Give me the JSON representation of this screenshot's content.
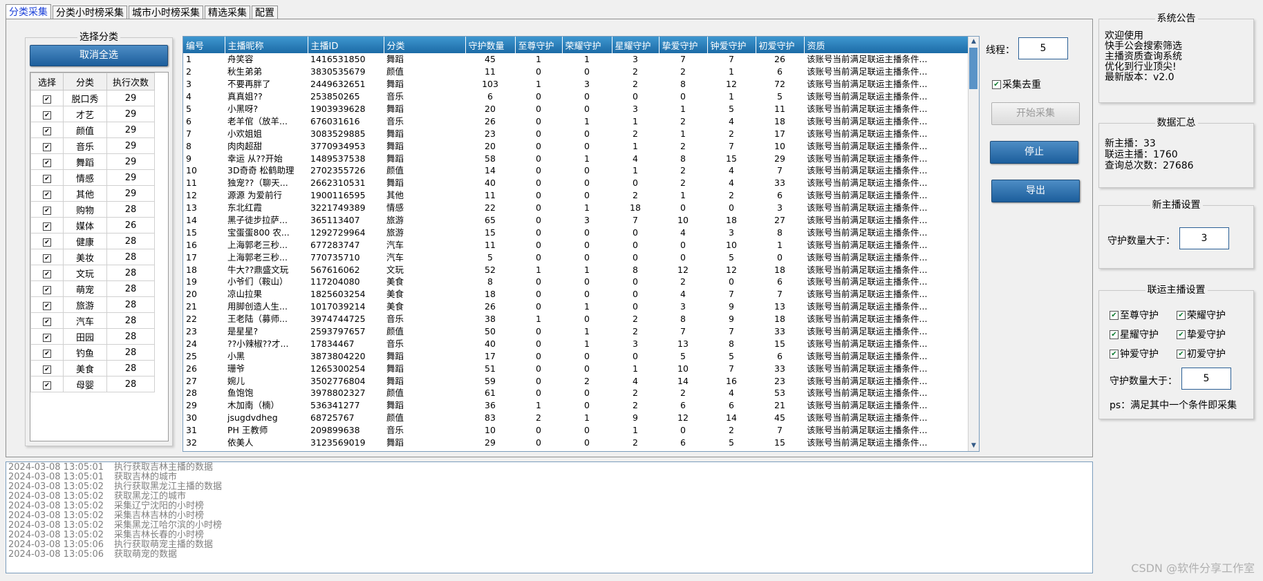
{
  "tabs": [
    "分类采集",
    "分类小时榜采集",
    "城市小时榜采集",
    "精选采集",
    "配置"
  ],
  "category_panel": {
    "title": "选择分类",
    "deselect_all": "取消全选",
    "headers": [
      "选择",
      "分类",
      "执行次数"
    ],
    "rows": [
      {
        "name": "脱口秀",
        "count": "29"
      },
      {
        "name": "才艺",
        "count": "29"
      },
      {
        "name": "颜值",
        "count": "29"
      },
      {
        "name": "音乐",
        "count": "29"
      },
      {
        "name": "舞蹈",
        "count": "29"
      },
      {
        "name": "情感",
        "count": "29"
      },
      {
        "name": "其他",
        "count": "29"
      },
      {
        "name": "购物",
        "count": "28"
      },
      {
        "name": "媒体",
        "count": "26"
      },
      {
        "name": "健康",
        "count": "28"
      },
      {
        "name": "美妆",
        "count": "28"
      },
      {
        "name": "文玩",
        "count": "28"
      },
      {
        "name": "萌宠",
        "count": "28"
      },
      {
        "name": "旅游",
        "count": "28"
      },
      {
        "name": "汽车",
        "count": "28"
      },
      {
        "name": "田园",
        "count": "28"
      },
      {
        "name": "钓鱼",
        "count": "28"
      },
      {
        "name": "美食",
        "count": "28"
      },
      {
        "name": "母婴",
        "count": "28"
      }
    ]
  },
  "grid": {
    "headers": [
      "编号",
      "主播昵称",
      "主播ID",
      "分类",
      "守护数量",
      "至尊守护",
      "荣耀守护",
      "星耀守护",
      "挚爱守护",
      "钟爱守护",
      "初爱守护",
      "资质"
    ],
    "qual": "该账号当前满足联运主播条件...",
    "rows": [
      [
        "1",
        "舟笑容",
        "1416531850",
        "舞蹈",
        "45",
        "1",
        "1",
        "3",
        "7",
        "7",
        "26"
      ],
      [
        "2",
        "秋生弟弟",
        "3830535679",
        "颜值",
        "11",
        "0",
        "0",
        "2",
        "2",
        "1",
        "6"
      ],
      [
        "3",
        "不要再胖了",
        "2449632651",
        "舞蹈",
        "103",
        "1",
        "3",
        "2",
        "8",
        "12",
        "72"
      ],
      [
        "4",
        "真真姐??",
        "253850265",
        "音乐",
        "6",
        "0",
        "0",
        "0",
        "0",
        "1",
        "5"
      ],
      [
        "5",
        "小黑呀?",
        "1903939628",
        "舞蹈",
        "20",
        "0",
        "0",
        "3",
        "1",
        "5",
        "11"
      ],
      [
        "6",
        "老羊倌（放羊...",
        "676031616",
        "音乐",
        "26",
        "0",
        "1",
        "1",
        "2",
        "4",
        "18"
      ],
      [
        "7",
        "小欢姐姐",
        "3083529885",
        "舞蹈",
        "23",
        "0",
        "0",
        "2",
        "1",
        "2",
        "17"
      ],
      [
        "8",
        "肉肉超甜",
        "3770934953",
        "舞蹈",
        "20",
        "0",
        "0",
        "1",
        "2",
        "7",
        "10"
      ],
      [
        "9",
        "幸运 从??开始",
        "1489537538",
        "舞蹈",
        "58",
        "0",
        "1",
        "4",
        "8",
        "15",
        "29"
      ],
      [
        "10",
        "3D奇奇 松鹤助理",
        "2702355726",
        "颜值",
        "14",
        "0",
        "0",
        "1",
        "2",
        "4",
        "7"
      ],
      [
        "11",
        "独宠??（聊天...",
        "2662310531",
        "舞蹈",
        "40",
        "0",
        "0",
        "0",
        "2",
        "4",
        "33"
      ],
      [
        "12",
        "源源 为爱前行",
        "1900116595",
        "其他",
        "11",
        "0",
        "0",
        "2",
        "1",
        "2",
        "6"
      ],
      [
        "13",
        "东北红霞",
        "3221749389",
        "情感",
        "22",
        "0",
        "1",
        "18",
        "0",
        "0",
        "3"
      ],
      [
        "14",
        "黑子徒步拉萨...",
        "365113407",
        "旅游",
        "65",
        "0",
        "3",
        "7",
        "10",
        "18",
        "27"
      ],
      [
        "15",
        "宝蛋蛋800 农...",
        "1292729964",
        "旅游",
        "15",
        "0",
        "0",
        "0",
        "4",
        "3",
        "8"
      ],
      [
        "16",
        "上海郭老三秒...",
        "677283747",
        "汽车",
        "11",
        "0",
        "0",
        "0",
        "0",
        "10",
        "1"
      ],
      [
        "17",
        "上海郭老三秒...",
        "770735710",
        "汽车",
        "5",
        "0",
        "0",
        "0",
        "0",
        "5",
        "0"
      ],
      [
        "18",
        "牛大??鼎盛文玩",
        "567616062",
        "文玩",
        "52",
        "1",
        "1",
        "8",
        "12",
        "12",
        "18"
      ],
      [
        "19",
        "小爷们（鞍山）",
        "117204080",
        "美食",
        "8",
        "0",
        "0",
        "0",
        "2",
        "0",
        "6"
      ],
      [
        "20",
        "凉山拉果",
        "1825603254",
        "美食",
        "18",
        "0",
        "0",
        "0",
        "4",
        "7",
        "7"
      ],
      [
        "21",
        "用脚创造人生...",
        "1017039214",
        "美食",
        "26",
        "0",
        "1",
        "0",
        "3",
        "9",
        "13"
      ],
      [
        "22",
        "王老陆（募师...",
        "3974744725",
        "音乐",
        "38",
        "1",
        "0",
        "2",
        "8",
        "9",
        "18"
      ],
      [
        "23",
        "是星星?",
        "2593797657",
        "颜值",
        "50",
        "0",
        "1",
        "2",
        "7",
        "7",
        "33"
      ],
      [
        "24",
        "??小辣椒??才...",
        "17834467",
        "音乐",
        "40",
        "0",
        "1",
        "3",
        "13",
        "8",
        "15"
      ],
      [
        "25",
        "小黑",
        "3873804220",
        "舞蹈",
        "17",
        "0",
        "0",
        "0",
        "5",
        "5",
        "6"
      ],
      [
        "26",
        "珊爷",
        "1265300254",
        "舞蹈",
        "51",
        "0",
        "0",
        "1",
        "10",
        "7",
        "33"
      ],
      [
        "27",
        "婉儿",
        "3502776804",
        "舞蹈",
        "59",
        "0",
        "2",
        "4",
        "14",
        "16",
        "23"
      ],
      [
        "28",
        "鱼饱饱",
        "3978802327",
        "颜值",
        "61",
        "0",
        "0",
        "2",
        "2",
        "4",
        "53"
      ],
      [
        "29",
        "木加南（楠）",
        "536341277",
        "舞蹈",
        "36",
        "1",
        "0",
        "2",
        "6",
        "6",
        "21"
      ],
      [
        "30",
        "jsugdvdheg",
        "68725767",
        "颜值",
        "83",
        "2",
        "1",
        "9",
        "12",
        "14",
        "45"
      ],
      [
        "31",
        "PH  王教师",
        "209899638",
        "音乐",
        "10",
        "0",
        "0",
        "1",
        "0",
        "2",
        "7"
      ],
      [
        "32",
        "依美人",
        "3123569019",
        "舞蹈",
        "29",
        "0",
        "0",
        "2",
        "6",
        "5",
        "15"
      ]
    ]
  },
  "controls": {
    "threads_label": "线程：",
    "threads_value": "5",
    "dedupe_label": "采集去重",
    "start": "开始采集",
    "stop": "停止",
    "export": "导出"
  },
  "announcement": {
    "title": "系统公告",
    "lines": [
      "欢迎使用",
      "快手公会搜索筛选",
      "主播资质查询系统",
      "优化到行业顶尖!",
      "最新版本：v2.0"
    ]
  },
  "summary": {
    "title": "数据汇总",
    "lines": [
      "新主播：33",
      "联运主播：1760",
      "查询总次数：27686"
    ]
  },
  "new_anchor": {
    "title": "新主播设置",
    "label": "守护数量大于：",
    "value": "3"
  },
  "joint_anchor": {
    "title": "联运主播设置",
    "checks": [
      "至尊守护",
      "荣耀守护",
      "星耀守护",
      "挚爱守护",
      "钟爱守护",
      "初爱守护"
    ],
    "label": "守护数量大于：",
    "value": "5",
    "note": "ps：满足其中一个条件即采集"
  },
  "log": [
    [
      "2024-03-08 13:05:01",
      "执行获取吉林主播的数据"
    ],
    [
      "2024-03-08 13:05:01",
      "获取吉林的城市"
    ],
    [
      "2024-03-08 13:05:02",
      "执行获取黑龙江主播的数据"
    ],
    [
      "2024-03-08 13:05:02",
      "获取黑龙江的城市"
    ],
    [
      "2024-03-08 13:05:02",
      "采集辽宁沈阳的小时榜"
    ],
    [
      "2024-03-08 13:05:02",
      "采集吉林吉林的小时榜"
    ],
    [
      "2024-03-08 13:05:02",
      "采集黑龙江哈尔滨的小时榜"
    ],
    [
      "2024-03-08 13:05:02",
      "采集吉林长春的小时榜"
    ],
    [
      "2024-03-08 13:05:06",
      "执行获取萌宠主播的数据"
    ],
    [
      "2024-03-08 13:05:06",
      "获取萌宠的数据"
    ]
  ],
  "watermark": "CSDN @软件分享工作室"
}
